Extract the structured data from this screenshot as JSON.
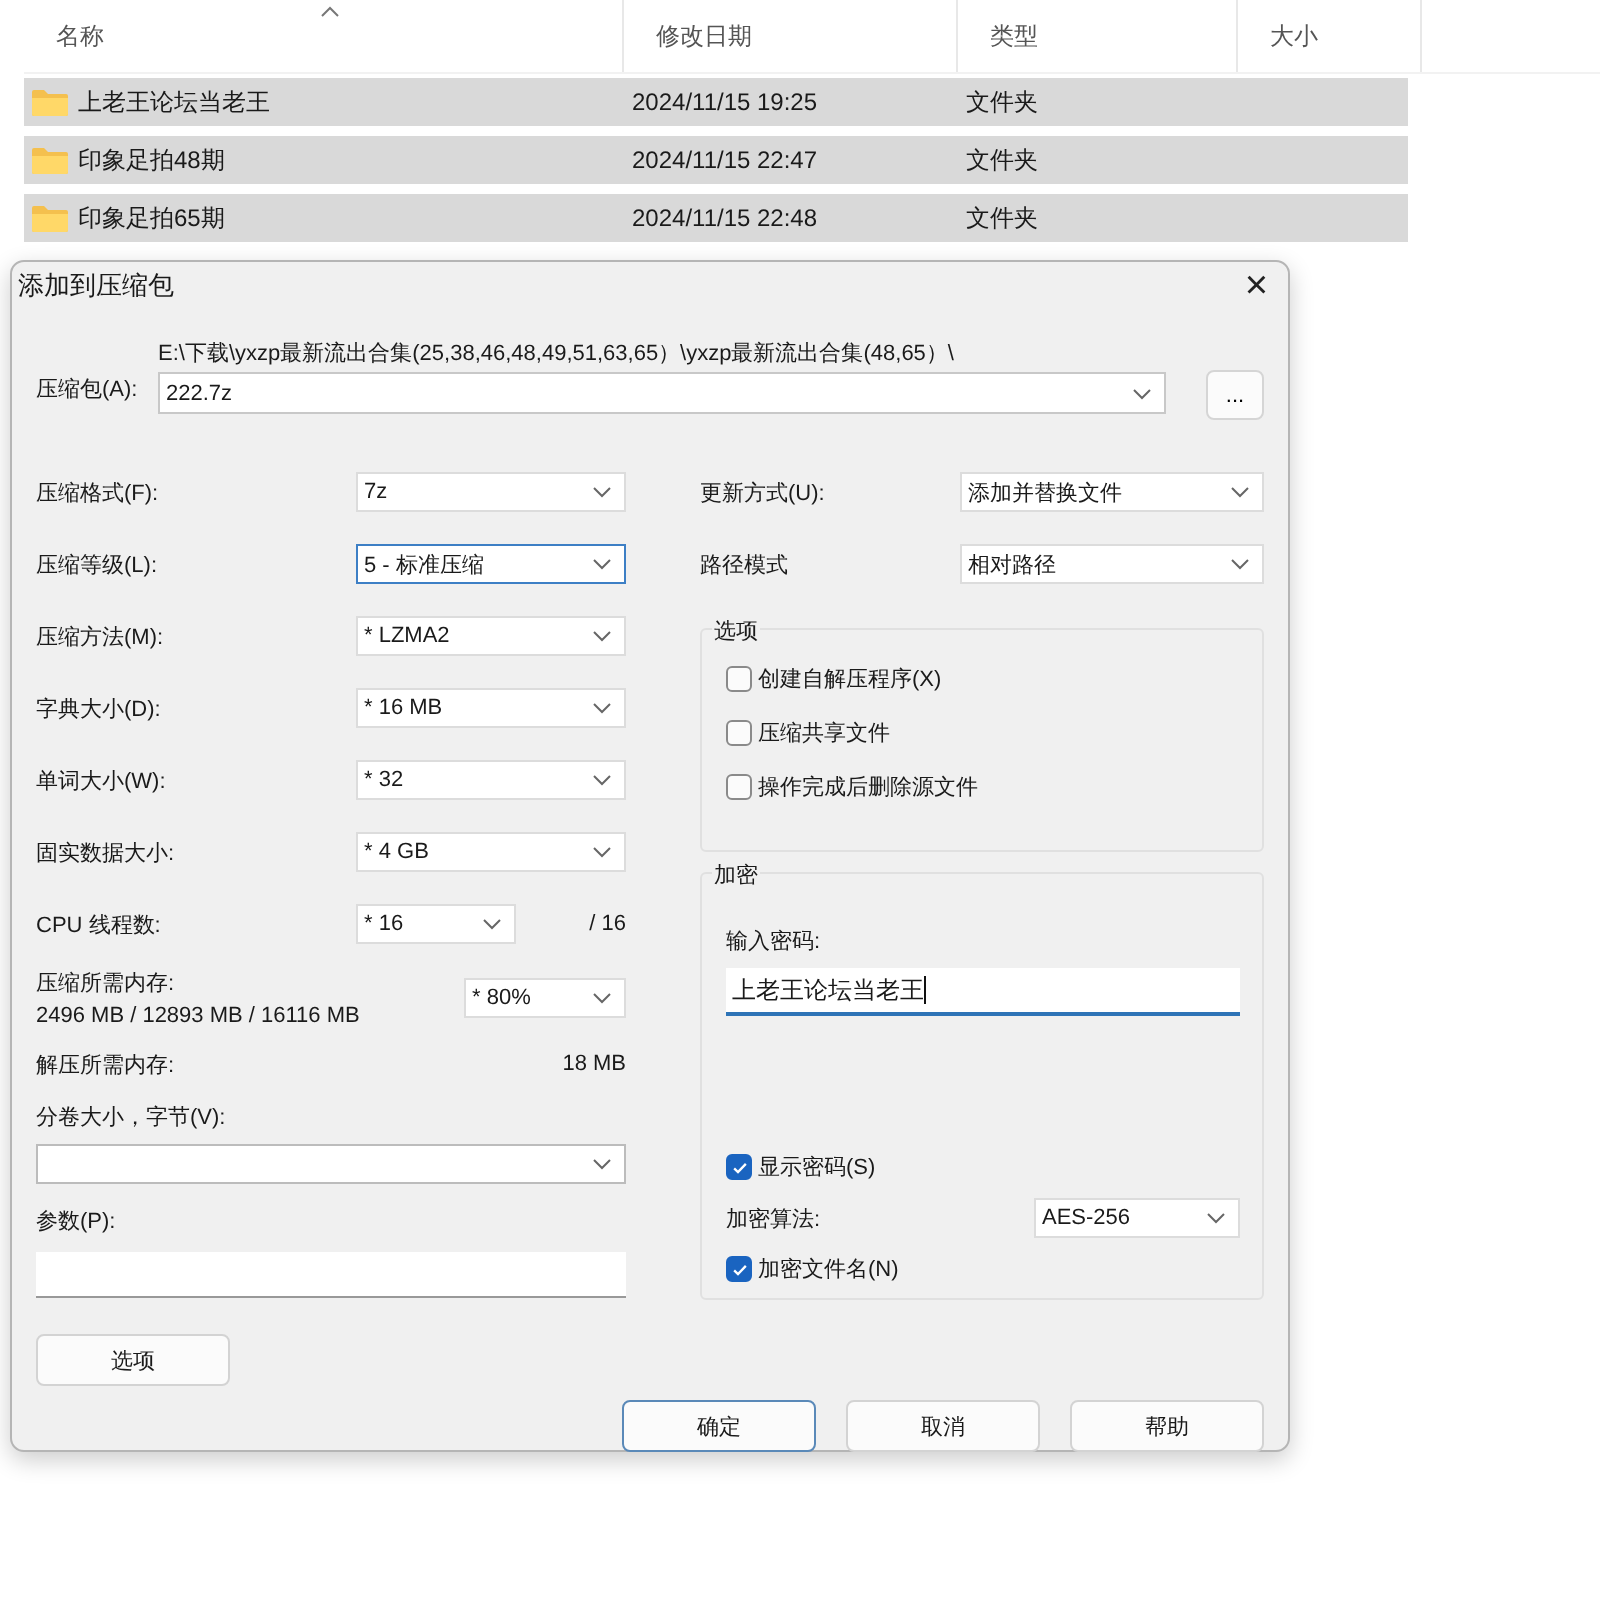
{
  "explorer": {
    "columns": [
      {
        "label": "名称",
        "sorted": true
      },
      {
        "label": "修改日期",
        "sorted": false
      },
      {
        "label": "类型",
        "sorted": false
      },
      {
        "label": "大小",
        "sorted": false
      }
    ],
    "rows": [
      {
        "name": "上老王论坛当老王",
        "date": "2024/11/15 19:25",
        "type": "文件夹",
        "selected": true
      },
      {
        "name": "印象足拍48期",
        "date": "2024/11/15 22:47",
        "type": "文件夹",
        "selected": true
      },
      {
        "name": "印象足拍65期",
        "date": "2024/11/15 22:48",
        "type": "文件夹",
        "selected": true
      }
    ]
  },
  "dialog": {
    "title": "添加到压缩包",
    "close": "×",
    "archive": {
      "label": "压缩包(A):",
      "path": "E:\\下载\\yxzp最新流出合集(25,38,46,48,49,51,63,65）\\yxzp最新流出合集(48,65）\\",
      "value": "222.7z",
      "browse": "..."
    },
    "left_settings": [
      {
        "label": "压缩格式(F):",
        "value": "7z",
        "focused": false
      },
      {
        "label": "压缩等级(L):",
        "value": "5 - 标准压缩",
        "focused": true
      },
      {
        "label": "压缩方法(M):",
        "value": "*  LZMA2",
        "focused": false
      },
      {
        "label": "字典大小(D):",
        "value": "*  16 MB",
        "focused": false
      },
      {
        "label": "单词大小(W):",
        "value": "*  32",
        "focused": false
      },
      {
        "label": "固实数据大小:",
        "value": "*  4 GB",
        "focused": false
      }
    ],
    "cpu": {
      "label": "CPU 线程数:",
      "value": "*  16",
      "max": "/ 16"
    },
    "memory": {
      "label": "压缩所需内存:",
      "usage": "2496 MB / 12893 MB / 16116 MB",
      "value": "*  80%"
    },
    "decompress": {
      "label": "解压所需内存:",
      "value": "18 MB"
    },
    "split": {
      "label": "分卷大小，字节(V):"
    },
    "params": {
      "label": "参数(P):"
    },
    "options_button": "选项",
    "right_settings": [
      {
        "label": "更新方式(U):",
        "value": "添加并替换文件"
      },
      {
        "label": "路径模式",
        "value": "相对路径"
      }
    ],
    "options_group": {
      "title": "选项",
      "items": [
        {
          "label": "创建自解压程序(X)",
          "checked": false
        },
        {
          "label": "压缩共享文件",
          "checked": false
        },
        {
          "label": "操作完成后删除源文件",
          "checked": false
        }
      ]
    },
    "encryption": {
      "title": "加密",
      "password_label": "输入密码:",
      "password": "上老王论坛当老王",
      "show_password": {
        "label": "显示密码(S)",
        "checked": true
      },
      "method_label": "加密算法:",
      "method": "AES-256",
      "encrypt_names": {
        "label": "加密文件名(N)",
        "checked": true
      }
    },
    "buttons": [
      {
        "label": "确定",
        "default": true
      },
      {
        "label": "取消",
        "default": false
      },
      {
        "label": "帮助",
        "default": false
      }
    ]
  }
}
